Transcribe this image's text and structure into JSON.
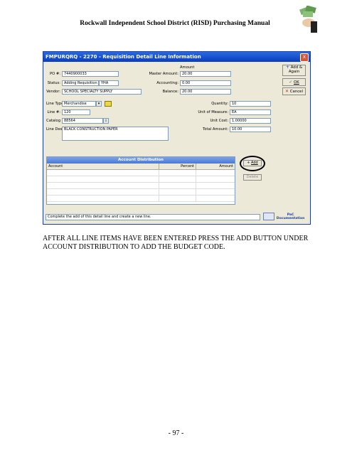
{
  "document": {
    "header": "Rockwall Independent School District (RISD) Purchasing Manual",
    "caption": "AFTER ALL LINE ITEMS HAVE BEEN ENTERED PRESS THE ADD BUTTON UNDER ACCOUNT DISTRIBUTION TO ADD THE BUDGET CODE.",
    "page_number": "- 97 -"
  },
  "window": {
    "title": "FMPURQRQ - 2270 - Requisition Detail Line Information",
    "close": "x"
  },
  "header_fields": {
    "po_label": "PO #:",
    "po_value": "7440900033",
    "status_label": "Status:",
    "status_value": "Adding Requisition",
    "status_extra": "YHA",
    "vendor_label": "Vendor:",
    "vendor_value": "SCHOOL SPECIALTY SUPPLY",
    "amount_heading": "Amount",
    "master_amount_label": "Master Amount:",
    "master_amount_value": "20.00",
    "accounting_label": "Accounting:",
    "accounting_value": "0.00",
    "balance_label": "Balance:",
    "balance_value": "20.00"
  },
  "line_fields": {
    "line_type_label": "Line Type:",
    "line_type_value": "Merchandise",
    "line_no_label": "Line #:",
    "line_no_value": "120",
    "catalog_label": "Catalog",
    "catalog_value": "88564",
    "line_desc_label": "Line Desc:",
    "line_desc_value": "BLACK CONSTRUCTION PAPER",
    "quantity_label": "Quantity:",
    "quantity_value": "10",
    "uom_label": "Unit of Measure:",
    "uom_value": "EA",
    "unit_cost_label": "Unit Cost:",
    "unit_cost_value": "1.00000",
    "total_label": "Total Amount:",
    "total_value": "10.00"
  },
  "side_buttons": {
    "add_again": "Add & Again",
    "ok": "OK",
    "cancel": "Cancel"
  },
  "account_distribution": {
    "title": "Account Distribution",
    "columns": [
      "Account",
      "Percent",
      "Amount"
    ],
    "add_button": "Add",
    "delete_button": "Delete"
  },
  "status_message": "Complete the add of this detail line and create a new line.",
  "logo_text": "PaC Documentation"
}
